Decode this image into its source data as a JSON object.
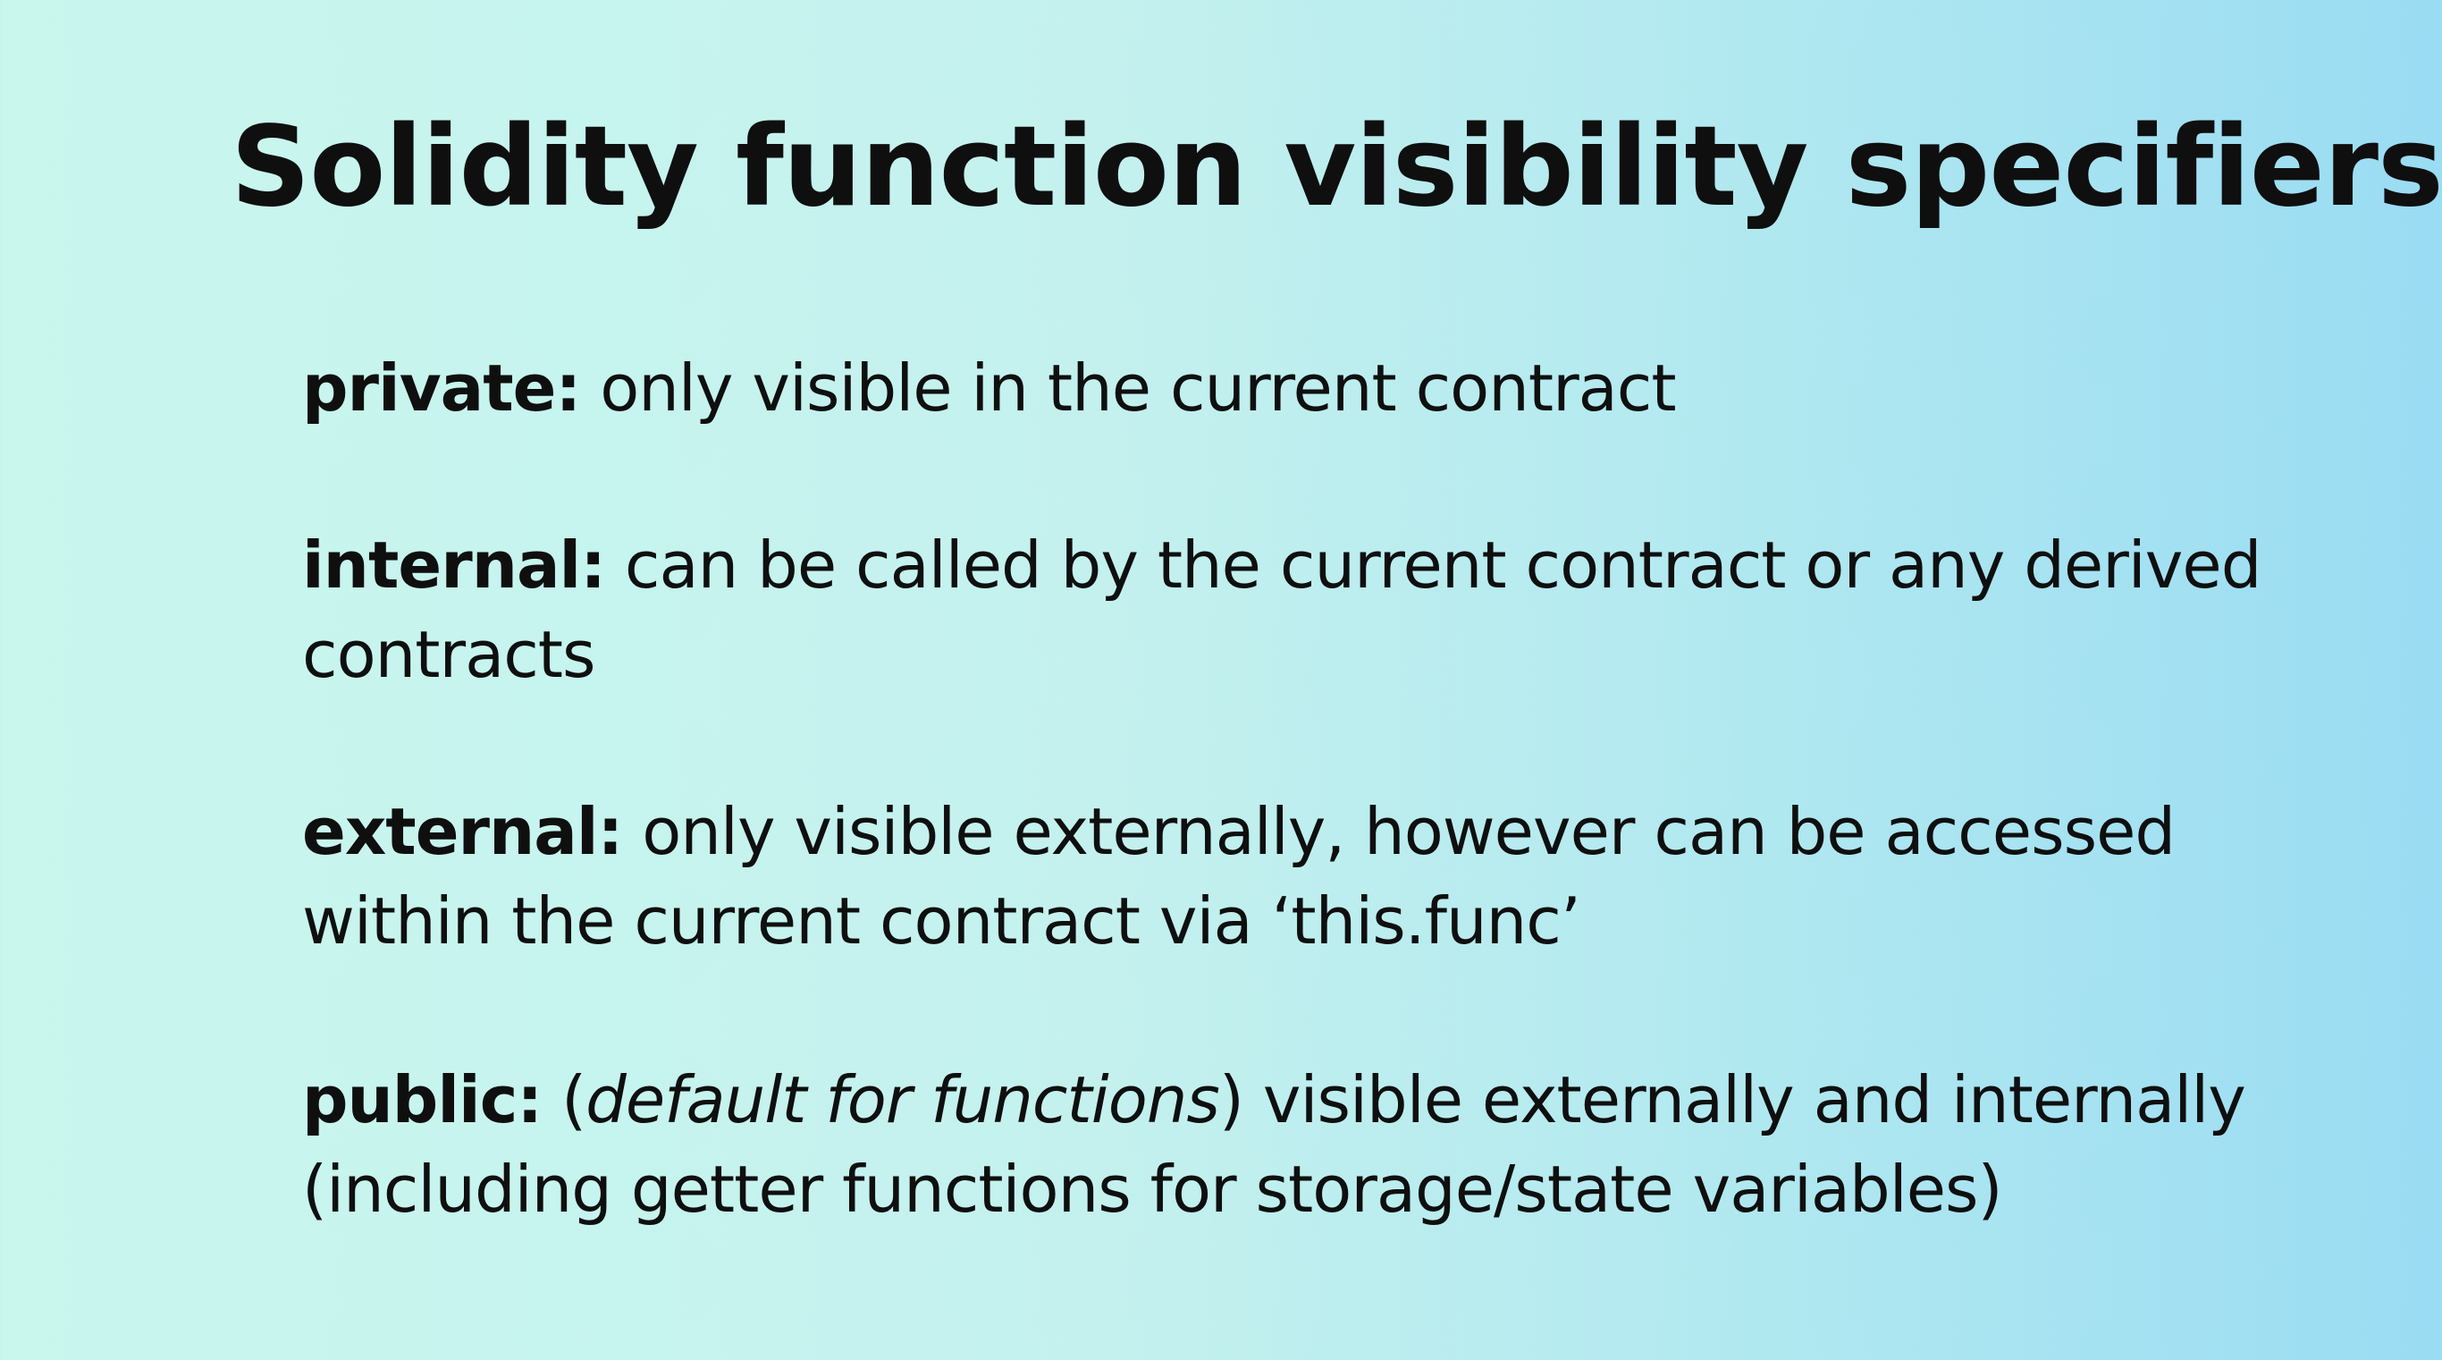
{
  "slide": {
    "title": "Solidity function visibility specifiers:",
    "items": [
      {
        "term": "private:",
        "description": "only visible in the current contract"
      },
      {
        "term": "internal:",
        "description": "can be called by the current contract or any derived contracts"
      },
      {
        "term": "external:",
        "description": "only visible externally, however can be accessed within the current contract via ‘this.func’"
      },
      {
        "term": "public:",
        "paren_open": "(",
        "note": "default for functions",
        "paren_close": ")",
        "description": "visible externally and internally (including getter functions for storage/state variables)"
      }
    ]
  },
  "colors": {
    "background_left": "#c9f7ee",
    "background_right": "#9adcf3",
    "text": "#0f0f0f"
  }
}
